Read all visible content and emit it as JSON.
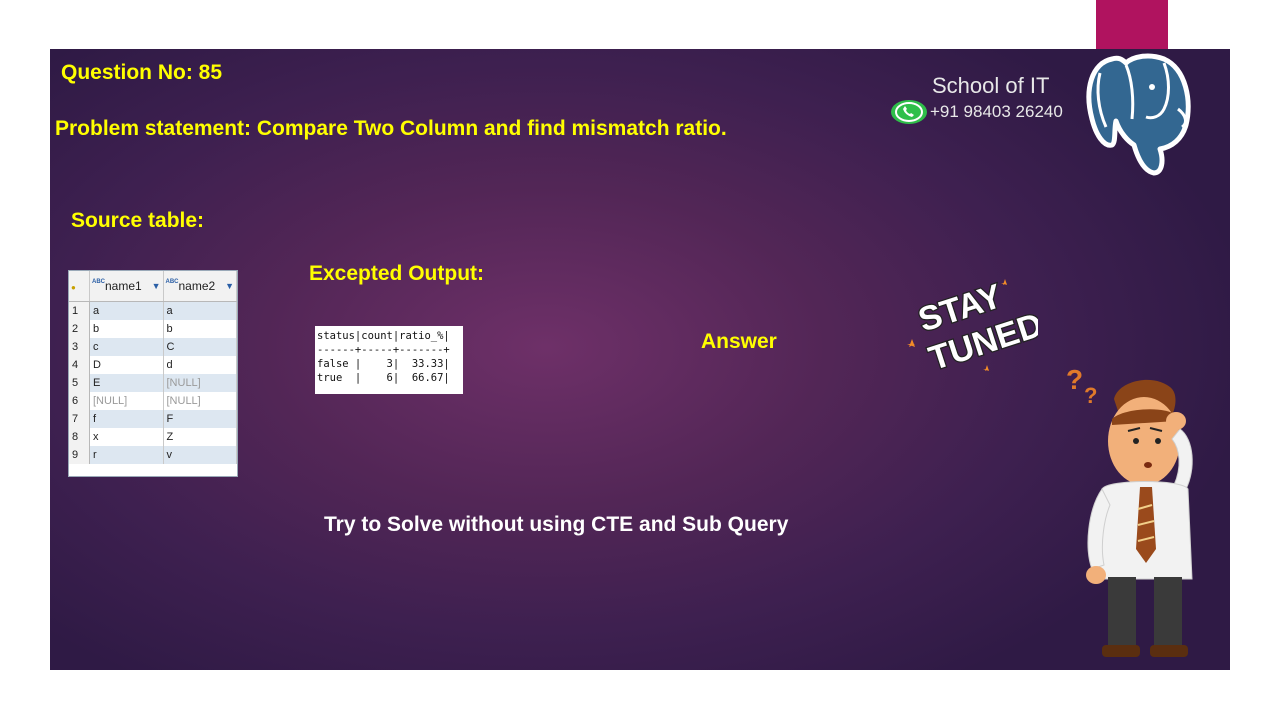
{
  "slide": {
    "question_no": "Question No: 85",
    "problem_statement": "Problem statement: Compare Two Column and find mismatch ratio.",
    "source_label": "Source table:",
    "expected_label": "Excepted Output:",
    "answer_label": "Answer",
    "try_text": "Try to Solve without using CTE and Sub Query"
  },
  "brand": {
    "name": "School of IT",
    "phone": "+91 98403 26240",
    "icons": [
      "whatsapp-icon",
      "postgresql-elephant-logo"
    ]
  },
  "source_table": {
    "columns": [
      "name1",
      "name2"
    ],
    "type_badge": "ABC",
    "rows": [
      {
        "n": "1",
        "name1": "a",
        "name2": "a"
      },
      {
        "n": "2",
        "name1": "b",
        "name2": "b"
      },
      {
        "n": "3",
        "name1": "c",
        "name2": "C"
      },
      {
        "n": "4",
        "name1": "D",
        "name2": "d"
      },
      {
        "n": "5",
        "name1": "E",
        "name2": "[NULL]"
      },
      {
        "n": "6",
        "name1": "[NULL]",
        "name2": "[NULL]"
      },
      {
        "n": "7",
        "name1": "f",
        "name2": "F"
      },
      {
        "n": "8",
        "name1": "x",
        "name2": "Z"
      },
      {
        "n": "9",
        "name1": "r",
        "name2": "v"
      }
    ]
  },
  "expected_output": {
    "header": "status|count|ratio_%|",
    "separator": "------+-----+-------+",
    "rows": [
      "false |    3|  33.33|",
      "true  |    6|  66.67|"
    ]
  },
  "stay_tuned": {
    "line1": "STAY",
    "line2": "TUNED"
  },
  "colors": {
    "accent_yellow": "#ffff00",
    "slide_bg": "#4a2452",
    "brand_pink": "#b0135f"
  }
}
